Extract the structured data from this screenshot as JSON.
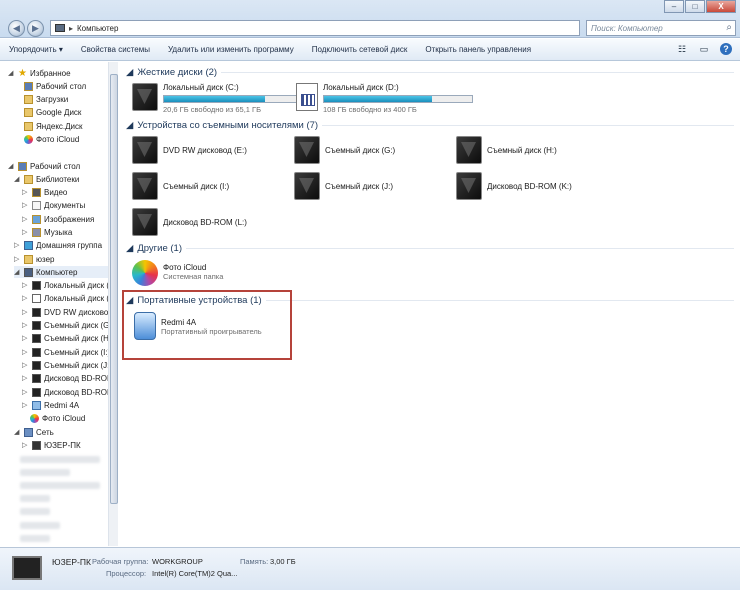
{
  "window": {
    "address": "Компьютер",
    "search_placeholder": "Поиск: Компьютер",
    "btn_min": "–",
    "btn_max": "□",
    "btn_close": "X"
  },
  "toolbar": {
    "organize": "Упорядочить ▾",
    "system_props": "Свойства системы",
    "uninstall": "Удалить или изменить программу",
    "map_drive": "Подключить сетевой диск",
    "control_panel": "Открыть панель управления"
  },
  "nav": {
    "favorites": "Избранное",
    "desktop": "Рабочий стол",
    "downloads": "Загрузки",
    "google": "Google Диск",
    "yandex": "Яндекс.Диск",
    "icloud_fav": "Фото iCloud",
    "desktop_root": "Рабочий стол",
    "libraries": "Библиотеки",
    "video": "Видео",
    "documents": "Документы",
    "images": "Изображения",
    "music": "Музыка",
    "homegroup": "Домашняя группа",
    "user": "юзер",
    "computer": "Компьютер",
    "c": "Локальный диск (C",
    "d": "Локальный диск (D",
    "dvd": "DVD RW дисковод (",
    "g": "Съемный диск (G:)",
    "h": "Съемный диск (H:)",
    "i": "Съемный диск (I:)",
    "j": "Съемный диск (J:)",
    "bd1": "Дисковод BD-ROM",
    "bd2": "Дисковод BD-ROM",
    "redmi": "Redmi 4A",
    "icloud": "Фото iCloud",
    "network": "Сеть",
    "pc": "ЮЗЕР-ПК"
  },
  "groups": {
    "hdd": "Жесткие диски (2)",
    "removable": "Устройства со съемными носителями (7)",
    "other": "Другие (1)",
    "portable": "Портативные устройства (1)"
  },
  "drives": {
    "c_name": "Локальный диск (C:)",
    "c_free": "20,6 ГБ свободно из 65,1 ГБ",
    "c_used_fraction": 0.68,
    "d_name": "Локальный диск (D:)",
    "d_free": "108 ГБ свободно из 400 ГБ",
    "d_used_fraction": 0.73
  },
  "removable": {
    "dvd": "DVD RW дисковод (E:)",
    "g": "Съемный диск (G:)",
    "h": "Съемный диск (H:)",
    "i": "Съемный диск (I:)",
    "j": "Съемный диск (J:)",
    "bdk": "Дисковод BD-ROM (K:)",
    "bdl": "Дисковод BD-ROM (L:)"
  },
  "other": {
    "icloud_name": "Фото iCloud",
    "icloud_sub": "Системная папка"
  },
  "portable": {
    "redmi_name": "Redmi 4A",
    "redmi_sub": "Портативный проигрыватель"
  },
  "status": {
    "pc": "ЮЗЕР-ПК",
    "workgroup_label": "Рабочая группа:",
    "workgroup": "WORKGROUP",
    "memory_label": "Память:",
    "memory": "3,00 ГБ",
    "cpu_label": "Процессор:",
    "cpu": "Intel(R) Core(TM)2 Qua..."
  }
}
